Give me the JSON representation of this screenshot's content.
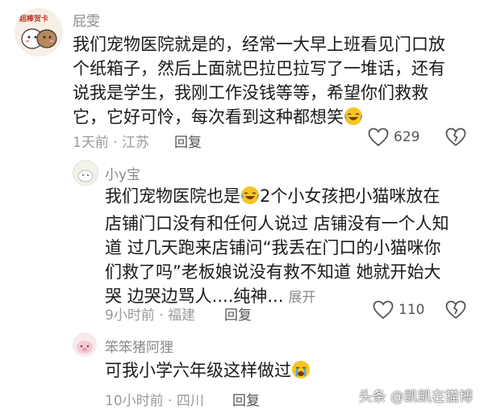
{
  "comments": [
    {
      "user": "屁雯",
      "avatar_text": "超棒贺卡",
      "lines": [
        "我们宠物医院就是的，经常一大早上班看见门口放",
        "个纸箱子，然后上面就巴拉巴拉写了一堆话，还有",
        "说我是学生，我刚工作没钱等等，希望你们救救",
        "它，它好可怜，每次看到这种都想笑"
      ],
      "time": "1天前",
      "location": "江苏",
      "reply_label": "回复",
      "likes": "629"
    },
    {
      "user": "小y宝",
      "lines": [
        "我们宠物医院也是",
        "2个小女孩把小猫咪放在",
        "店铺门口没有和任何人说过 店铺没有一个人知",
        "道 过几天跑来店铺问“我丢在门口的小猫咪你",
        "们救了吗”老板娘说没有救不知道 她就开始大",
        "哭 边哭边骂人....纯神..."
      ],
      "expand_label": "展开",
      "time": "9小时前",
      "location": "福建",
      "reply_label": "回复",
      "likes": "110"
    },
    {
      "user": "笨笨猪阿狸",
      "lines": [
        "可我小学六年级这样做过"
      ],
      "time": "10小时前",
      "location": "四川",
      "reply_label": "回复"
    }
  ],
  "meta_separator": " · ",
  "watermark": "头条 @凯凯在猫博",
  "colors": {
    "emoji_yellow": "#f7c325",
    "tear_blue": "#4aa8e8"
  }
}
